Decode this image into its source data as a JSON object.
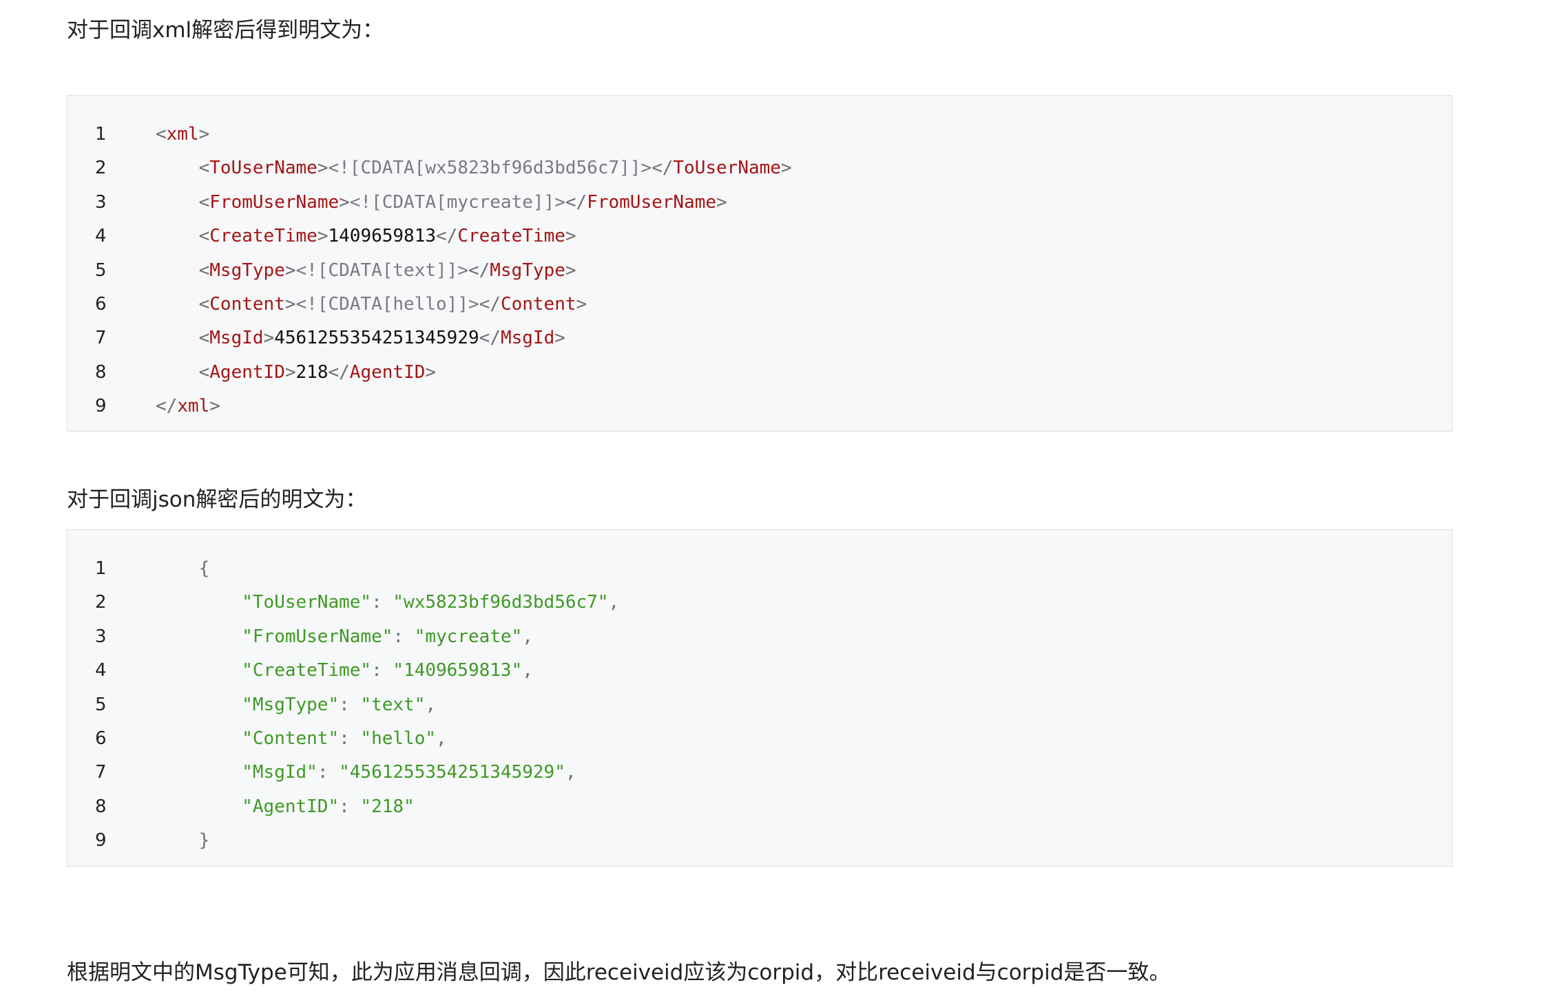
{
  "intro_xml": "对于回调xml解密后得到明文为：",
  "intro_json": "对于回调json解密后的明文为：",
  "conclusion": "根据明文中的MsgType可知，此为应用消息回调，因此receiveid应该为corpid，对比receiveid与corpid是否一致。",
  "xml_code": {
    "line_numbers": [
      "1",
      "2",
      "3",
      "4",
      "5",
      "6",
      "7",
      "8",
      "9"
    ],
    "lines": [
      {
        "indent": "",
        "tokens": [
          {
            "k": "p",
            "t": "<"
          },
          {
            "k": "t",
            "t": "xml"
          },
          {
            "k": "p",
            "t": ">"
          }
        ]
      },
      {
        "indent": "    ",
        "tokens": [
          {
            "k": "p",
            "t": "<"
          },
          {
            "k": "t",
            "t": "ToUserName"
          },
          {
            "k": "p",
            "t": ">"
          },
          {
            "k": "c",
            "t": "<![CDATA[wx5823bf96d3bd56c7]]>"
          },
          {
            "k": "p",
            "t": "</"
          },
          {
            "k": "t",
            "t": "ToUserName"
          },
          {
            "k": "p",
            "t": ">"
          }
        ]
      },
      {
        "indent": "    ",
        "tokens": [
          {
            "k": "p",
            "t": "<"
          },
          {
            "k": "t",
            "t": "FromUserName"
          },
          {
            "k": "p",
            "t": ">"
          },
          {
            "k": "c",
            "t": "<![CDATA[mycreate]]>"
          },
          {
            "k": "p",
            "t": "</"
          },
          {
            "k": "t",
            "t": "FromUserName"
          },
          {
            "k": "p",
            "t": ">"
          }
        ]
      },
      {
        "indent": "    ",
        "tokens": [
          {
            "k": "p",
            "t": "<"
          },
          {
            "k": "t",
            "t": "CreateTime"
          },
          {
            "k": "p",
            "t": ">"
          },
          {
            "k": "v",
            "t": "1409659813"
          },
          {
            "k": "p",
            "t": "</"
          },
          {
            "k": "t",
            "t": "CreateTime"
          },
          {
            "k": "p",
            "t": ">"
          }
        ]
      },
      {
        "indent": "    ",
        "tokens": [
          {
            "k": "p",
            "t": "<"
          },
          {
            "k": "t",
            "t": "MsgType"
          },
          {
            "k": "p",
            "t": ">"
          },
          {
            "k": "c",
            "t": "<![CDATA[text]]>"
          },
          {
            "k": "p",
            "t": "</"
          },
          {
            "k": "t",
            "t": "MsgType"
          },
          {
            "k": "p",
            "t": ">"
          }
        ]
      },
      {
        "indent": "    ",
        "tokens": [
          {
            "k": "p",
            "t": "<"
          },
          {
            "k": "t",
            "t": "Content"
          },
          {
            "k": "p",
            "t": ">"
          },
          {
            "k": "c",
            "t": "<![CDATA[hello]]>"
          },
          {
            "k": "p",
            "t": "</"
          },
          {
            "k": "t",
            "t": "Content"
          },
          {
            "k": "p",
            "t": ">"
          }
        ]
      },
      {
        "indent": "    ",
        "tokens": [
          {
            "k": "p",
            "t": "<"
          },
          {
            "k": "t",
            "t": "MsgId"
          },
          {
            "k": "p",
            "t": ">"
          },
          {
            "k": "v",
            "t": "4561255354251345929"
          },
          {
            "k": "p",
            "t": "</"
          },
          {
            "k": "t",
            "t": "MsgId"
          },
          {
            "k": "p",
            "t": ">"
          }
        ]
      },
      {
        "indent": "    ",
        "tokens": [
          {
            "k": "p",
            "t": "<"
          },
          {
            "k": "t",
            "t": "AgentID"
          },
          {
            "k": "p",
            "t": ">"
          },
          {
            "k": "v",
            "t": "218"
          },
          {
            "k": "p",
            "t": "</"
          },
          {
            "k": "t",
            "t": "AgentID"
          },
          {
            "k": "p",
            "t": ">"
          }
        ]
      },
      {
        "indent": "",
        "tokens": [
          {
            "k": "p",
            "t": "</"
          },
          {
            "k": "t",
            "t": "xml"
          },
          {
            "k": "p",
            "t": ">"
          }
        ]
      }
    ]
  },
  "json_code": {
    "line_numbers": [
      "1",
      "2",
      "3",
      "4",
      "5",
      "6",
      "7",
      "8",
      "9"
    ],
    "lines": [
      {
        "indent": "    ",
        "tokens": [
          {
            "k": "p",
            "t": "{"
          }
        ]
      },
      {
        "indent": "        ",
        "tokens": [
          {
            "k": "s",
            "t": "\"ToUserName\""
          },
          {
            "k": "p",
            "t": ": "
          },
          {
            "k": "s",
            "t": "\"wx5823bf96d3bd56c7\""
          },
          {
            "k": "p",
            "t": ","
          }
        ]
      },
      {
        "indent": "        ",
        "tokens": [
          {
            "k": "s",
            "t": "\"FromUserName\""
          },
          {
            "k": "p",
            "t": ": "
          },
          {
            "k": "s",
            "t": "\"mycreate\""
          },
          {
            "k": "p",
            "t": ","
          }
        ]
      },
      {
        "indent": "        ",
        "tokens": [
          {
            "k": "s",
            "t": "\"CreateTime\""
          },
          {
            "k": "p",
            "t": ": "
          },
          {
            "k": "s",
            "t": "\"1409659813\""
          },
          {
            "k": "p",
            "t": ","
          }
        ]
      },
      {
        "indent": "        ",
        "tokens": [
          {
            "k": "s",
            "t": "\"MsgType\""
          },
          {
            "k": "p",
            "t": ": "
          },
          {
            "k": "s",
            "t": "\"text\""
          },
          {
            "k": "p",
            "t": ","
          }
        ]
      },
      {
        "indent": "        ",
        "tokens": [
          {
            "k": "s",
            "t": "\"Content\""
          },
          {
            "k": "p",
            "t": ": "
          },
          {
            "k": "s",
            "t": "\"hello\""
          },
          {
            "k": "p",
            "t": ","
          }
        ]
      },
      {
        "indent": "        ",
        "tokens": [
          {
            "k": "s",
            "t": "\"MsgId\""
          },
          {
            "k": "p",
            "t": ": "
          },
          {
            "k": "s",
            "t": "\"4561255354251345929\""
          },
          {
            "k": "p",
            "t": ","
          }
        ]
      },
      {
        "indent": "        ",
        "tokens": [
          {
            "k": "s",
            "t": "\"AgentID\""
          },
          {
            "k": "p",
            "t": ": "
          },
          {
            "k": "s",
            "t": "\"218\""
          }
        ]
      },
      {
        "indent": "    ",
        "tokens": [
          {
            "k": "p",
            "t": "}"
          }
        ]
      }
    ]
  }
}
